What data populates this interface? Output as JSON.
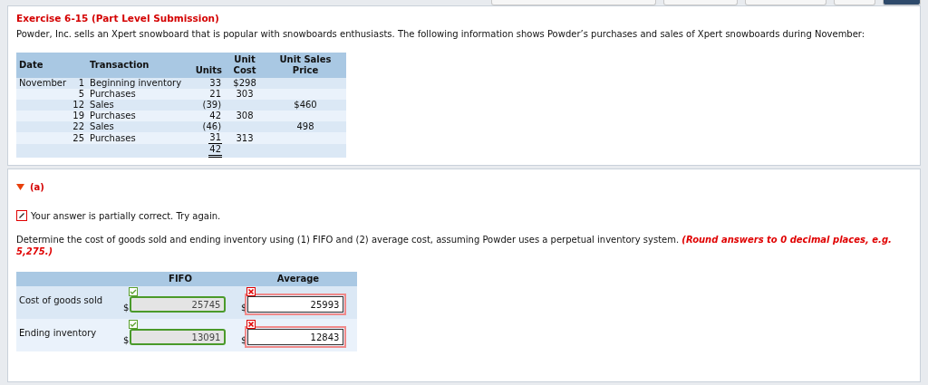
{
  "exercise": {
    "title": "Exercise 6-15 (Part Level Submission)",
    "intro": "Powder, Inc. sells an Xpert snowboard that is popular with snowboards enthusiasts. The following information shows Powder’s purchases and sales of Xpert snowboards during November:"
  },
  "inventory_table": {
    "columns": [
      "Date",
      "Transaction",
      "Units",
      "Unit Cost",
      "Unit Sales Price"
    ],
    "rows": [
      {
        "kind": "entry",
        "month": "November",
        "day": "1",
        "transaction": "Beginning inventory",
        "units": "33",
        "unit_cost": "$298",
        "unit_sales_price": ""
      },
      {
        "kind": "entry",
        "month": "",
        "day": "5",
        "transaction": "Purchases",
        "units": "21",
        "unit_cost": "303",
        "unit_sales_price": ""
      },
      {
        "kind": "entry",
        "month": "",
        "day": "12",
        "transaction": "Sales",
        "units": "(39)",
        "unit_cost": "",
        "unit_sales_price": "$460"
      },
      {
        "kind": "entry",
        "month": "",
        "day": "19",
        "transaction": "Purchases",
        "units": "42",
        "unit_cost": "308",
        "unit_sales_price": ""
      },
      {
        "kind": "entry",
        "month": "",
        "day": "22",
        "transaction": "Sales",
        "units": "(46)",
        "unit_cost": "",
        "unit_sales_price": "498"
      },
      {
        "kind": "last",
        "month": "",
        "day": "25",
        "transaction": "Purchases",
        "units": "31",
        "unit_cost": "313",
        "unit_sales_price": ""
      },
      {
        "kind": "total",
        "month": "",
        "day": "",
        "transaction": "",
        "units": "42",
        "unit_cost": "",
        "unit_sales_price": ""
      }
    ]
  },
  "part": {
    "label": "(a)",
    "expanded": true,
    "feedback": "Your answer is partially correct.  Try again.",
    "question": "Determine the cost of goods sold and ending inventory using (1) FIFO and (2) average cost, assuming Powder uses a perpetual inventory system.",
    "hint": "(Round answers to 0 decimal places, e.g. 5,275.)"
  },
  "answer_table": {
    "columns": [
      "FIFO",
      "Average"
    ],
    "rows": [
      {
        "label": "Cost of goods sold",
        "fields": [
          {
            "currency": "$",
            "value": "25745",
            "correct": true
          },
          {
            "currency": "$",
            "value": "25993",
            "correct": false
          }
        ]
      },
      {
        "label": "Ending inventory",
        "fields": [
          {
            "currency": "$",
            "value": "13091",
            "correct": true
          },
          {
            "currency": "$",
            "value": "12843",
            "correct": false
          }
        ]
      }
    ]
  }
}
